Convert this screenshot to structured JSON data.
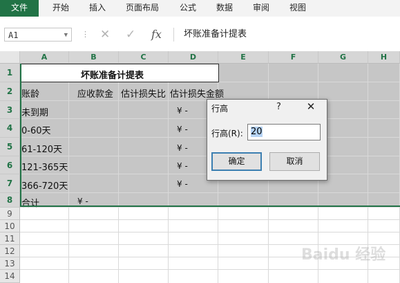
{
  "ribbon": {
    "tabs": [
      "文件",
      "开始",
      "插入",
      "页面布局",
      "公式",
      "数据",
      "审阅",
      "视图"
    ]
  },
  "formula_bar": {
    "name_box": "A1",
    "cancel_icon": "✕",
    "enter_icon": "✓",
    "fx_label": "fx",
    "content": "坏账准备计提表"
  },
  "columns": [
    "A",
    "B",
    "C",
    "D",
    "E",
    "F",
    "G",
    "H"
  ],
  "rows": [
    "1",
    "2",
    "3",
    "4",
    "5",
    "6",
    "7",
    "8",
    "9",
    "10",
    "11",
    "12",
    "13",
    "14"
  ],
  "sheet": {
    "title": "坏账准备计提表",
    "headers": {
      "a": "账龄",
      "b": "应收款金",
      "c": "估计损失比",
      "d": "估计损失金额"
    },
    "aging_rows": [
      "未到期",
      "0-60天",
      "61-120天",
      "121-365天",
      "366-720天"
    ],
    "total_label": "合计",
    "currency_dash": "¥    -",
    "currency_dash_total": "¥    -"
  },
  "dialog": {
    "title": "行高",
    "help": "?",
    "close": "✕",
    "label": "行高(R):",
    "value": "20",
    "ok": "确定",
    "cancel": "取消"
  },
  "watermark": "Baidu 经验"
}
